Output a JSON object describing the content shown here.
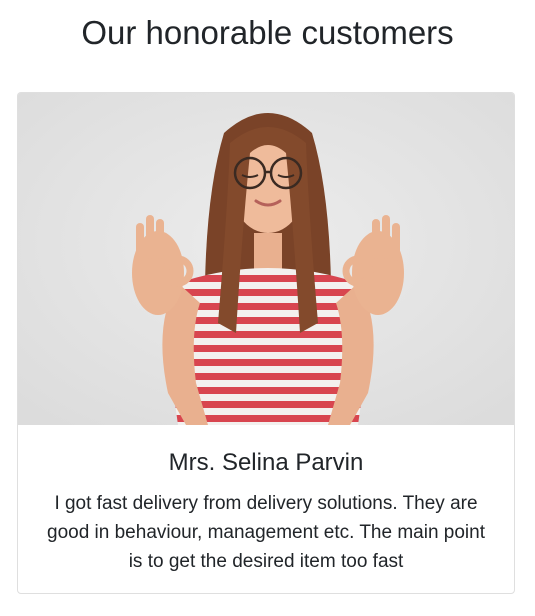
{
  "section": {
    "title": "Our honorable customers"
  },
  "testimonial": {
    "photo_icon": "customer-photo",
    "name": "Mrs. Selina Parvin",
    "quote": "I got fast delivery from delivery solutions. They are good in behaviour, management etc. The main point is to get the desired item too fast"
  },
  "colors": {
    "text": "#212529",
    "photo_background": "#e3e3e3",
    "card_border": "rgba(0,0,0,0.125)"
  }
}
